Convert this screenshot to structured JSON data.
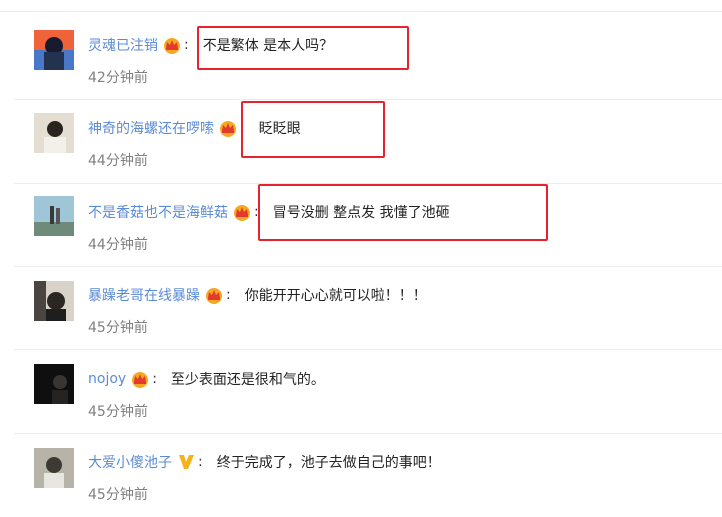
{
  "comments": [
    {
      "username": "灵魂已注销",
      "text": "不是繁体 是本人吗？",
      "time": "42分钟前",
      "badge": "crown-icon"
    },
    {
      "username": "神奇的海螺还在啰嗦",
      "text": "眨眨眼",
      "time": "44分钟前",
      "badge": "crown-icon"
    },
    {
      "username": "不是香菇也不是海鲜菇",
      "text": "冒号没删 整点发 我懂了池砸",
      "time": "44分钟前",
      "badge": "crown-icon"
    },
    {
      "username": "暴躁老哥在线暴躁",
      "text": "你能开开心心就可以啦！！！",
      "time": "45分钟前",
      "badge": "crown-icon"
    },
    {
      "username": "nojoy",
      "text": "至少表面还是很和气的。",
      "time": "45分钟前",
      "badge": "crown-icon"
    },
    {
      "username": "大爱小傻池子",
      "text": "终于完成了，池子去做自己的事吧！",
      "time": "45分钟前",
      "badge": "verified-v-icon"
    }
  ],
  "separator": ":",
  "colors": {
    "username": "#5b8bd6",
    "highlight_box": "#e6232e",
    "time": "#808080"
  }
}
